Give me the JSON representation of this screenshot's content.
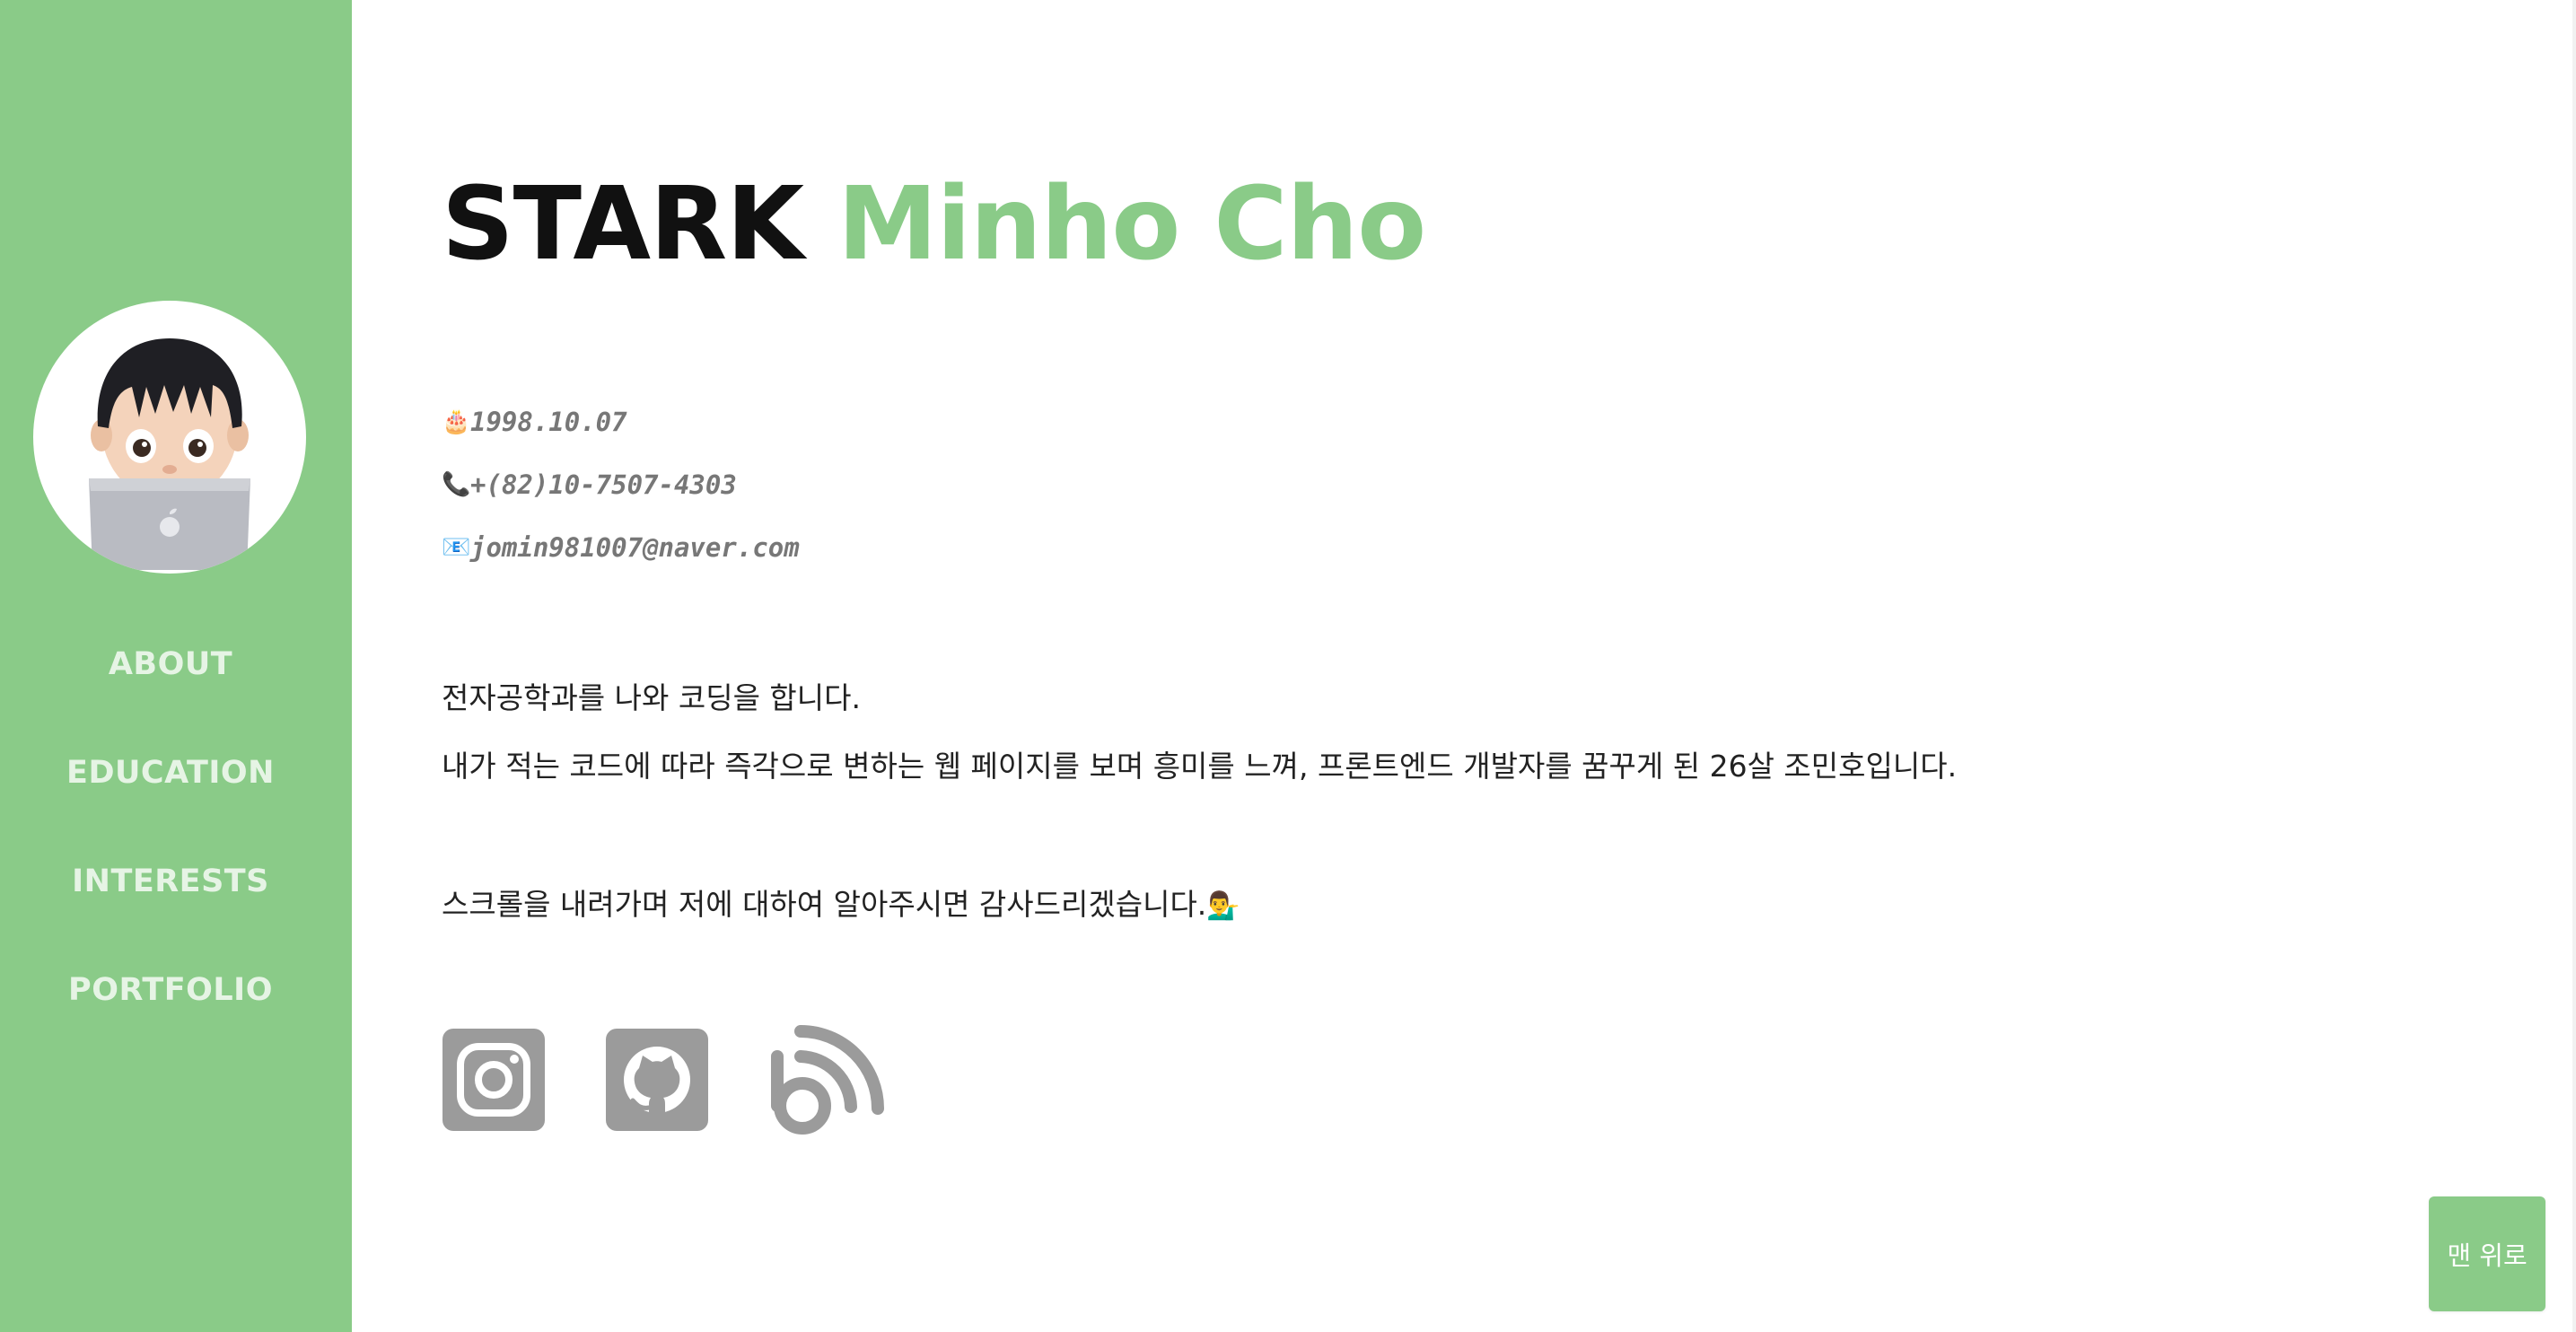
{
  "colors": {
    "accent": "#8acb88",
    "nav_text": "#e6f4e5",
    "title_dark": "#111111",
    "muted": "#777777",
    "icon_gray": "#9b9b9b"
  },
  "sidebar": {
    "avatar": {
      "icon": "memoji-avatar-with-laptop"
    },
    "nav": [
      {
        "label": "ABOUT"
      },
      {
        "label": "EDUCATION"
      },
      {
        "label": "INTERESTS"
      },
      {
        "label": "PORTFOLIO"
      }
    ]
  },
  "header": {
    "title_first": "STARK",
    "title_name": "Minho Cho"
  },
  "info": [
    {
      "icon": "cake-icon",
      "glyph": "🎂",
      "value": "1998.10.07"
    },
    {
      "icon": "phone-icon",
      "glyph": "📞",
      "value": "+(82)10-7507-4303"
    },
    {
      "icon": "email-icon",
      "glyph": "📧",
      "value": "jomin981007@naver.com"
    }
  ],
  "intro": {
    "line1": "전자공학과를 나와 코딩을 합니다.",
    "line2": "내가 적는 코드에 따라 즉각으로 변하는 웹 페이지를 보며 흥미를 느껴, 프론트엔드 개발자를 꿈꾸게 된 26살 조민호입니다.",
    "line3": "스크롤을 내려가며 저에 대하여 알아주시면 감사드리겠습니다.",
    "line3_emoji": "💁‍♂️"
  },
  "socials": [
    {
      "icon": "instagram-icon"
    },
    {
      "icon": "github-icon"
    },
    {
      "icon": "blog-icon"
    }
  ],
  "top_button": {
    "label": "맨 위로"
  }
}
